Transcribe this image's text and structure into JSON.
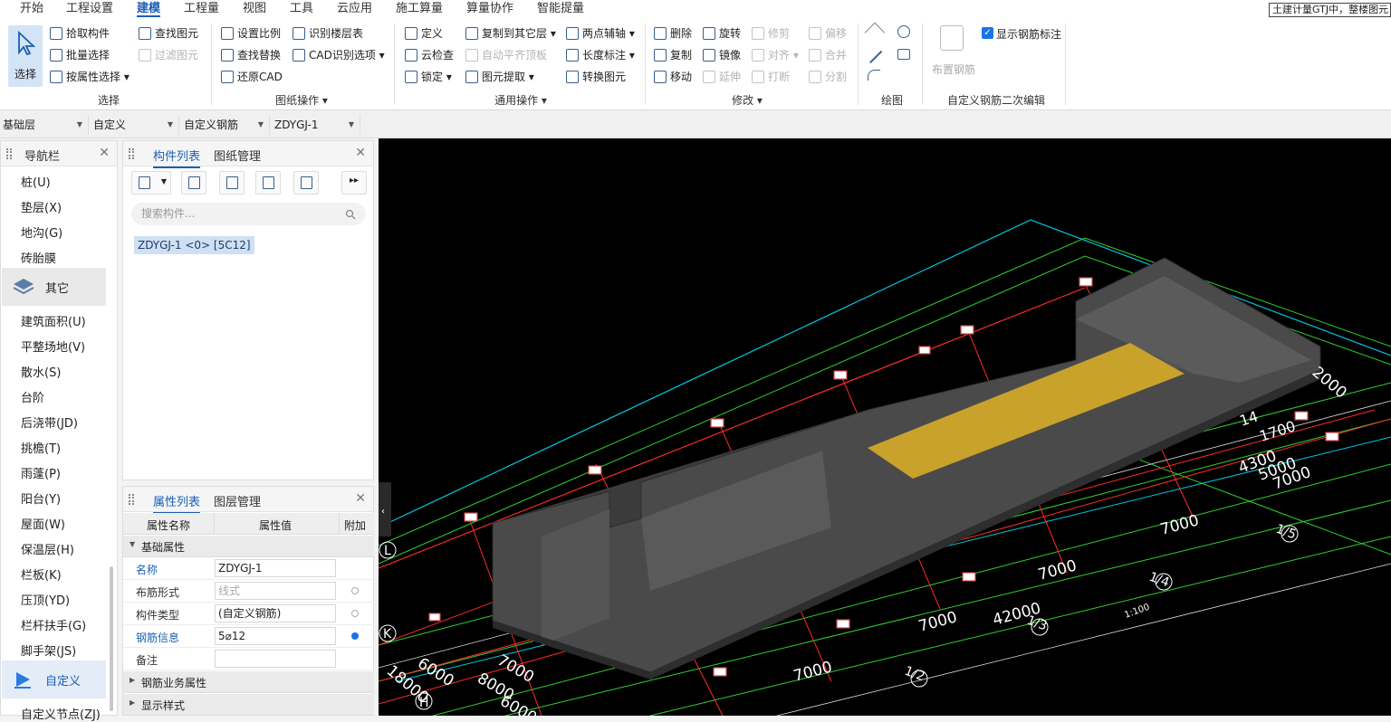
{
  "menu": {
    "tabs": [
      "开始",
      "工程设置",
      "建模",
      "工程量",
      "视图",
      "工具",
      "云应用",
      "施工算量",
      "算量协作",
      "智能提量"
    ],
    "active_tab": "建模",
    "hint": "土建计量GTJ中，整楼图元"
  },
  "ribbon": {
    "select": {
      "big_label": "选择",
      "pick": "拾取构件",
      "batch": "批量选择",
      "by_attr": "按属性选择",
      "find": "查找图元",
      "filter": "过滤图元",
      "group": "选择"
    },
    "drawing": {
      "scale": "设置比例",
      "floor_table": "识别楼层表",
      "find_replace": "查找替换",
      "cad_options": "CAD识别选项",
      "restore": "还原CAD",
      "group": "图纸操作"
    },
    "common": {
      "define": "定义",
      "copy_layer": "复制到其它层",
      "axis": "两点辅轴",
      "cloud_check": "云检查",
      "auto_align": "自动平齐顶板",
      "length_mark": "长度标注",
      "lock": "锁定",
      "extract": "图元提取",
      "convert": "转换图元",
      "group": "通用操作"
    },
    "modify": {
      "delete": "删除",
      "rotate": "旋转",
      "trim": "修剪",
      "offset": "偏移",
      "copy": "复制",
      "mirror": "镜像",
      "align": "对齐",
      "merge": "合并",
      "move": "移动",
      "extend": "延伸",
      "break": "打断",
      "split": "分割",
      "group": "修改"
    },
    "draw": {
      "group": "绘图"
    },
    "rebar": {
      "place": "布置钢筋",
      "show_mark": "显示钢筋标注",
      "group": "自定义钢筋二次编辑"
    }
  },
  "layerbar": {
    "floor": "基础层",
    "type": "自定义",
    "sub": "自定义钢筋",
    "item": "ZDYGJ-1"
  },
  "nav": {
    "title": "导航栏",
    "items_top": [
      "桩(U)",
      "垫层(X)",
      "地沟(G)",
      "砖胎膜"
    ],
    "section_other": "其它",
    "items_other": [
      "建筑面积(U)",
      "平整场地(V)",
      "散水(S)",
      "台阶",
      "后浇带(JD)",
      "挑檐(T)",
      "雨蓬(P)",
      "阳台(Y)",
      "屋面(W)",
      "保温层(H)",
      "栏板(K)",
      "压顶(YD)",
      "栏杆扶手(G)",
      "脚手架(JS)"
    ],
    "section_custom": "自定义",
    "items_custom": [
      "自定义节点(ZJ)"
    ]
  },
  "components": {
    "tab_list": "构件列表",
    "tab_drawings": "图纸管理",
    "search_placeholder": "搜索构件...",
    "item": "ZDYGJ-1 <0> [5C12]"
  },
  "properties": {
    "tab_attrs": "属性列表",
    "tab_layers": "图层管理",
    "col_name": "属性名称",
    "col_value": "属性值",
    "col_extra": "附加",
    "section_basic": "基础属性",
    "rows": [
      {
        "name": "名称",
        "value": "ZDYGJ-1"
      },
      {
        "name": "布筋形式",
        "value": "线式"
      },
      {
        "name": "构件类型",
        "value": "(自定义钢筋)"
      },
      {
        "name": "钢筋信息",
        "value": "5⌀12"
      },
      {
        "name": "备注",
        "value": ""
      }
    ],
    "section_business": "钢筋业务属性",
    "section_display": "显示样式"
  },
  "viewport": {
    "axis_labels": [
      "L",
      "K",
      "H"
    ],
    "dims": [
      "7000",
      "7000",
      "7000",
      "7000",
      "42000",
      "6000",
      "18000",
      "7000",
      "8000",
      "6000",
      "4300",
      "5000",
      "7000",
      "1/4",
      "1/3",
      "1/2",
      "1/5",
      "14",
      "1700",
      "1:100",
      "2000"
    ]
  }
}
